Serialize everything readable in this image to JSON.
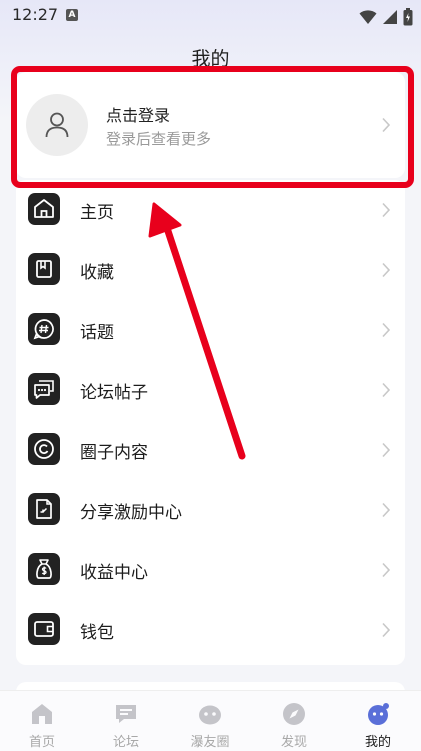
{
  "status_bar": {
    "time": "12:27",
    "notification_letter": "A"
  },
  "header": {
    "title": "我的"
  },
  "login": {
    "title": "点击登录",
    "subtitle": "登录后查看更多"
  },
  "menu": {
    "items": [
      {
        "label": "主页",
        "icon": "home-icon"
      },
      {
        "label": "收藏",
        "icon": "bookmark-icon"
      },
      {
        "label": "话题",
        "icon": "hashtag-icon"
      },
      {
        "label": "论坛帖子",
        "icon": "chat-icon"
      },
      {
        "label": "圈子内容",
        "icon": "circle-icon"
      },
      {
        "label": "分享激励中心",
        "icon": "document-icon"
      },
      {
        "label": "收益中心",
        "icon": "money-bag-icon"
      },
      {
        "label": "钱包",
        "icon": "wallet-icon"
      }
    ]
  },
  "bottom_nav": {
    "items": [
      {
        "label": "首页",
        "icon": "home-nav-icon",
        "active": false
      },
      {
        "label": "论坛",
        "icon": "forum-nav-icon",
        "active": false
      },
      {
        "label": "瀑友圈",
        "icon": "moments-nav-icon",
        "active": false
      },
      {
        "label": "发现",
        "icon": "discover-nav-icon",
        "active": false
      },
      {
        "label": "我的",
        "icon": "profile-nav-icon",
        "active": true
      }
    ]
  },
  "colors": {
    "highlight": "#e8001c",
    "icon_tile": "#222222",
    "muted_text": "#9a9a9a",
    "accent_profile": "#5a6fd8"
  }
}
